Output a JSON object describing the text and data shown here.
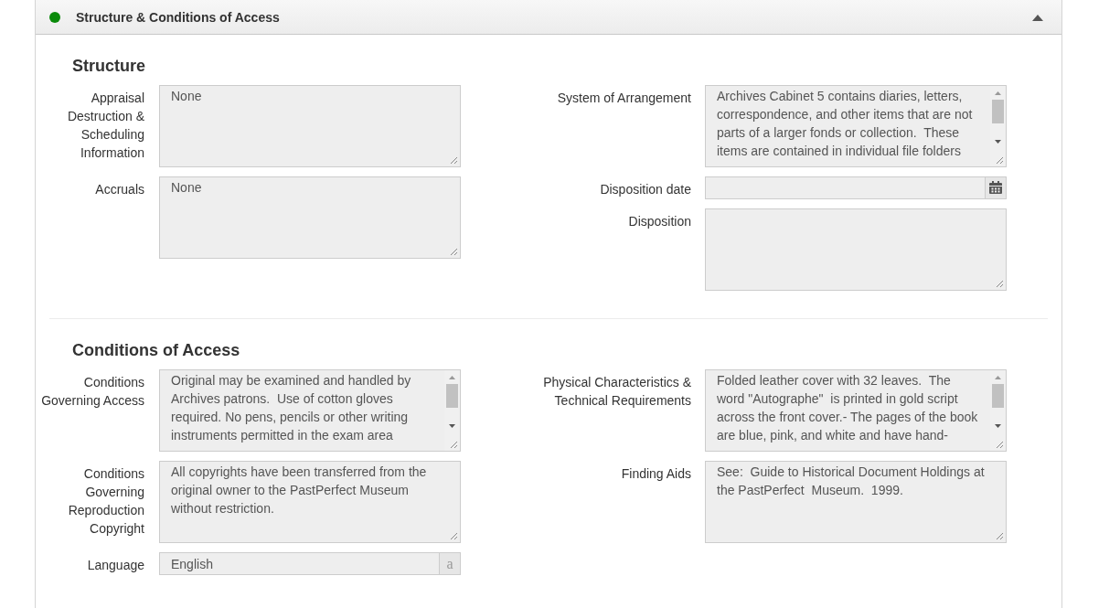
{
  "panel": {
    "title": "Structure & Conditions of Access",
    "expanded": true
  },
  "sections": [
    {
      "heading": "Structure",
      "columns": [
        [
          {
            "kind": "textarea",
            "label": "Appraisal Destruction & Scheduling Information",
            "value": "None"
          },
          {
            "kind": "textarea",
            "label": "Accruals",
            "value": "None"
          }
        ],
        [
          {
            "kind": "scroll",
            "label": "System of Arrangement",
            "value": "Archives Cabinet 5 contains diaries, letters, correspondence, and other items that are not parts of a larger fonds or collection.  These items are contained in individual file folders"
          },
          {
            "kind": "date",
            "label": "Disposition date"
          },
          {
            "kind": "textarea",
            "label": "Disposition"
          }
        ]
      ]
    },
    {
      "heading": "Conditions of Access",
      "columns": [
        [
          {
            "kind": "scroll",
            "label": "Conditions Governing Access",
            "value": "Original may be examined and handled by Archives patrons.  Use of cotton gloves required. No pens, pencils or other writing instruments permitted in the exam area"
          },
          {
            "kind": "textarea",
            "label": "Conditions Governing Reproduction Copyright",
            "value": "All copyrights have been transferred from the original owner to the PastPerfect Museum without restriction."
          },
          {
            "kind": "lookup",
            "label": "Language",
            "value": "English",
            "addon": "a"
          }
        ],
        [
          {
            "kind": "scroll",
            "label": "Physical Characteristics & Technical Requirements",
            "value": "Folded leather cover with 32 leaves.  The word \"Autographe\"  is printed in gold script across the front cover.- The pages of the book are blue, pink, and white and have hand-"
          },
          {
            "kind": "textarea",
            "label": "Finding Aids",
            "value": "See:  Guide to Historical Document Holdings at the PastPerfect  Museum.  1999."
          }
        ]
      ]
    }
  ]
}
